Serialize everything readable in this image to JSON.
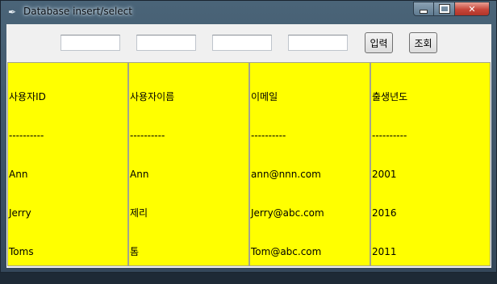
{
  "window": {
    "title": "Database insert/select",
    "controls": [
      "minimize",
      "maximize",
      "close"
    ],
    "close_glyph": "✕"
  },
  "toolbar": {
    "inputs": [
      {
        "value": "",
        "placeholder": ""
      },
      {
        "value": "",
        "placeholder": ""
      },
      {
        "value": "",
        "placeholder": ""
      },
      {
        "value": "",
        "placeholder": ""
      }
    ],
    "insert_label": "입력",
    "select_label": "조회"
  },
  "columns": [
    {
      "header": "사용자ID",
      "separator": "----------",
      "values": [
        "Ann",
        "Jerry",
        "Toms"
      ]
    },
    {
      "header": "사용자이름",
      "separator": "----------",
      "values": [
        "Ann",
        "제리",
        "톰"
      ]
    },
    {
      "header": "이메일",
      "separator": "----------",
      "values": [
        "ann@nnn.com",
        "Jerry@abc.com",
        "Tom@abc.com"
      ]
    },
    {
      "header": "출생년도",
      "separator": "----------",
      "values": [
        "2001",
        "2016",
        "2011"
      ]
    }
  ],
  "colors": {
    "column_bg": "#ffff00",
    "client_bg": "#f0f0f0"
  }
}
